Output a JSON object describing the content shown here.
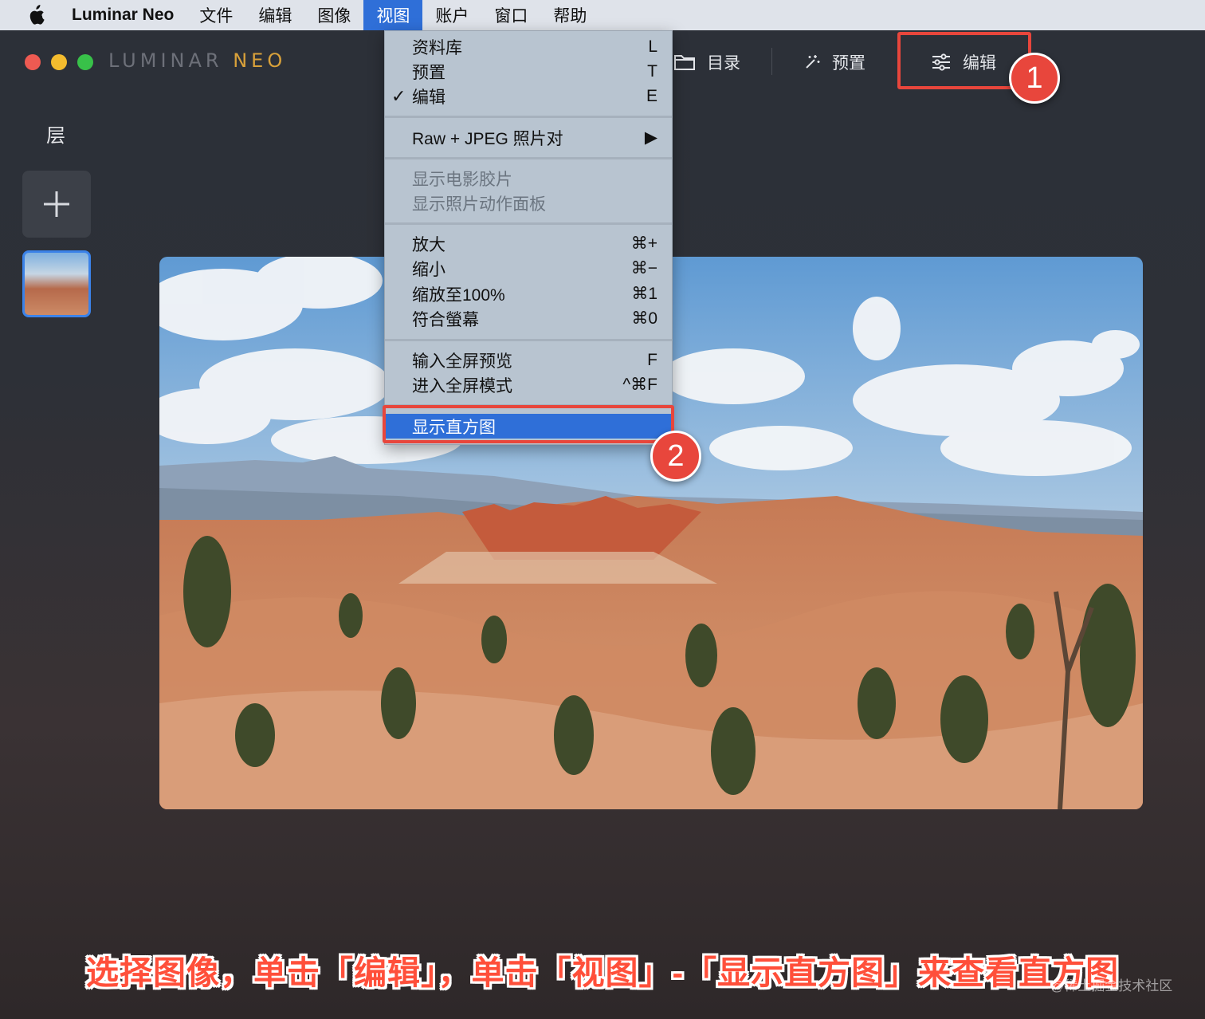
{
  "menubar": {
    "app_name": "Luminar Neo",
    "menus": [
      "文件",
      "编辑",
      "图像",
      "视图",
      "账户",
      "窗口",
      "帮助"
    ],
    "active_menu": "视图"
  },
  "app": {
    "brand_main": "LUMINAR",
    "brand_accent": "NEO",
    "nav": {
      "catalog": "目录",
      "presets": "预置",
      "edit": "编辑"
    },
    "sidebar": {
      "layers_label": "层"
    }
  },
  "view_menu": {
    "items": [
      {
        "label": "资料库",
        "shortcut": "L"
      },
      {
        "label": "预置",
        "shortcut": "T"
      },
      {
        "label": "编辑",
        "shortcut": "E",
        "checked": "✓"
      },
      {
        "label": "Raw + JPEG 照片对",
        "shortcut": "▶"
      },
      {
        "label": "显示电影胶片",
        "shortcut": ""
      },
      {
        "label": "显示照片动作面板",
        "shortcut": ""
      },
      {
        "label": "放大",
        "shortcut": "⌘+"
      },
      {
        "label": "缩小",
        "shortcut": "⌘−"
      },
      {
        "label": "缩放至100%",
        "shortcut": "⌘1"
      },
      {
        "label": "符合螢幕",
        "shortcut": "⌘0"
      },
      {
        "label": "输入全屏预览",
        "shortcut": "F"
      },
      {
        "label": "进入全屏模式",
        "shortcut": "^⌘F"
      },
      {
        "label": "显示直方图",
        "shortcut": ""
      }
    ]
  },
  "annotations": {
    "badge1": "1",
    "badge2": "2"
  },
  "caption": "选择图像，单击「编辑」，单击「视图」-「显示直方图」来查看直方图",
  "watermark": "@稀土掘金技术社区",
  "colors": {
    "accent": "#2f6fd8",
    "annotation": "#e8463c",
    "brand_neo": "#d9a13a"
  },
  "icons": [
    "apple-logo-icon",
    "folder-icon",
    "magic-wand-icon",
    "sliders-icon",
    "plus-icon",
    "checkmark-icon",
    "submenu-arrow-icon"
  ]
}
